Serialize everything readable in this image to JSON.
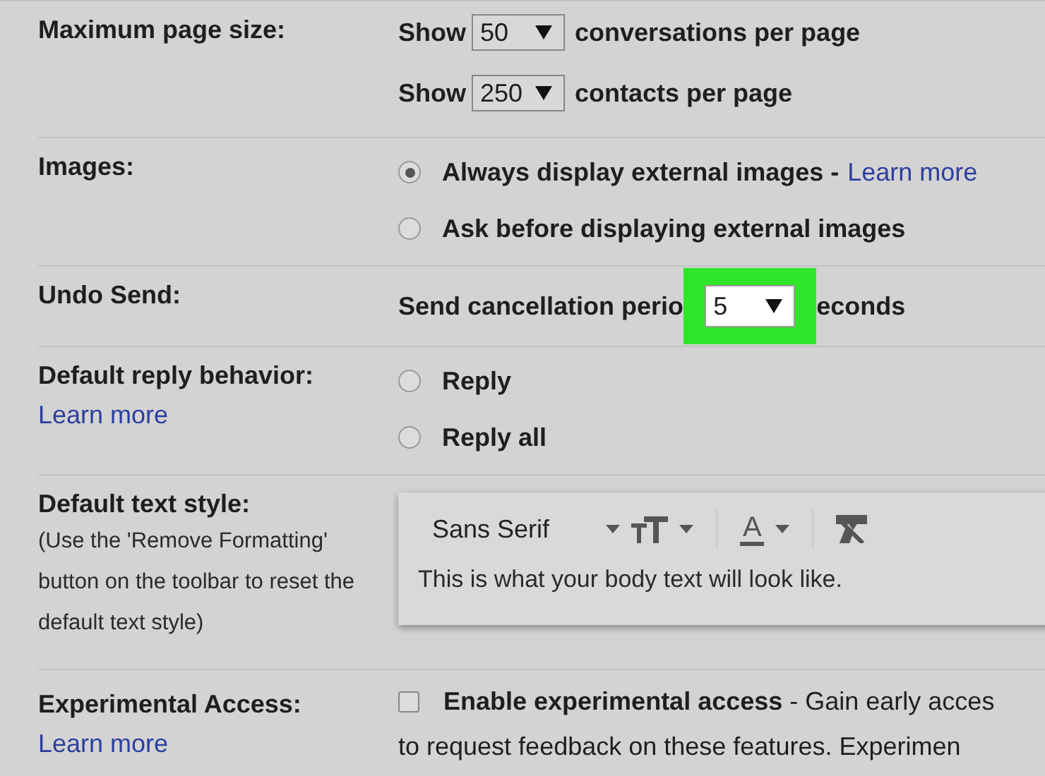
{
  "rows": [
    {
      "kind": "page_size",
      "label": "Maximum page size:",
      "lines": [
        {
          "prefix": "Show",
          "value": "50",
          "suffix": "conversations per page"
        },
        {
          "prefix": "Show",
          "value": "250",
          "suffix": "contacts per page"
        }
      ]
    },
    {
      "kind": "radios",
      "label": "Images:",
      "options": [
        {
          "text": "Always display external images -",
          "link": "Learn more",
          "selected": true
        },
        {
          "text": "Ask before displaying external images",
          "selected": false
        }
      ]
    },
    {
      "kind": "select",
      "label": "Undo Send:",
      "before": "Send cancellation perio",
      "value": "5",
      "after": "econds",
      "highlighted": true
    },
    {
      "kind": "radios",
      "label": "Default reply behavior:",
      "label_link": "Learn more",
      "options": [
        {
          "text": "Reply",
          "selected": false
        },
        {
          "text": "Reply all",
          "selected": false
        }
      ]
    },
    {
      "kind": "text_style",
      "label": "Default text style:",
      "note": "(Use the 'Remove Formatting' button on the toolbar to reset the default text style)",
      "font": "Sans Serif",
      "color_icon": "A",
      "preview": "This is what your body text will look like."
    },
    {
      "kind": "checkbox",
      "label": "Experimental Access:",
      "label_link": "Learn more",
      "checked": false,
      "lines": [
        "**Enable experimental access** - Gain early acces",
        "to request feedback on these features. Experimen"
      ]
    }
  ]
}
